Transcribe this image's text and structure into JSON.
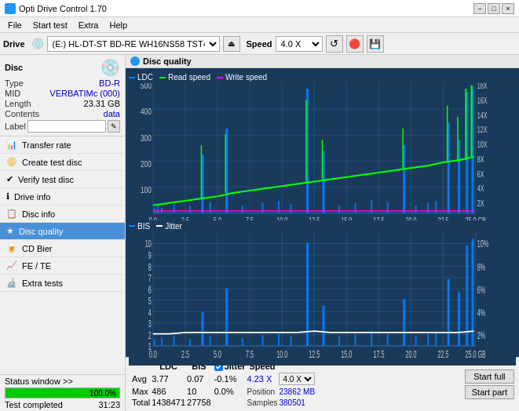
{
  "app": {
    "title": "Opti Drive Control 1.70",
    "icon": "disc-icon"
  },
  "titlebar": {
    "minimize": "−",
    "maximize": "□",
    "close": "×"
  },
  "menu": {
    "items": [
      "File",
      "Start test",
      "Extra",
      "Help"
    ]
  },
  "drive_bar": {
    "drive_label": "Drive",
    "drive_value": "(E:)  HL-DT-ST BD-RE  WH16NS58 TST4",
    "speed_label": "Speed",
    "speed_value": "4.0 X"
  },
  "disc": {
    "title": "Disc",
    "type_label": "Type",
    "type_value": "BD-R",
    "mid_label": "MID",
    "mid_value": "VERBATIMc (000)",
    "length_label": "Length",
    "length_value": "23.31 GB",
    "contents_label": "Contents",
    "contents_value": "data",
    "label_label": "Label",
    "label_placeholder": ""
  },
  "nav": {
    "items": [
      {
        "id": "transfer-rate",
        "label": "Transfer rate",
        "icon": "chart-icon"
      },
      {
        "id": "create-test-disc",
        "label": "Create test disc",
        "icon": "disc-write-icon"
      },
      {
        "id": "verify-test-disc",
        "label": "Verify test disc",
        "icon": "verify-icon"
      },
      {
        "id": "drive-info",
        "label": "Drive info",
        "icon": "info-icon"
      },
      {
        "id": "disc-info",
        "label": "Disc info",
        "icon": "disc-info-icon"
      },
      {
        "id": "disc-quality",
        "label": "Disc quality",
        "icon": "quality-icon",
        "active": true
      },
      {
        "id": "cd-bier",
        "label": "CD Bier",
        "icon": "cd-icon"
      },
      {
        "id": "fe-te",
        "label": "FE / TE",
        "icon": "fe-icon"
      },
      {
        "id": "extra-tests",
        "label": "Extra tests",
        "icon": "extra-icon"
      }
    ]
  },
  "status_window": {
    "label": "Status window >>",
    "progress": 100.0,
    "progress_text": "100.0%",
    "status_text": "Test completed",
    "time": "31:23"
  },
  "chart": {
    "title": "Disc quality",
    "top": {
      "legend": [
        "LDC",
        "Read speed",
        "Write speed"
      ],
      "y_max": 500,
      "y_right_max": 18,
      "x_max": 25,
      "y_labels": [
        "500",
        "400",
        "300",
        "200",
        "100"
      ],
      "y_right_labels": [
        "18X",
        "16X",
        "14X",
        "12X",
        "10X",
        "8X",
        "6X",
        "4X",
        "2X"
      ],
      "x_labels": [
        "0.0",
        "2.5",
        "5.0",
        "7.5",
        "10.0",
        "12.5",
        "15.0",
        "17.5",
        "20.0",
        "22.5",
        "25.0 GB"
      ]
    },
    "bottom": {
      "legend": [
        "BIS",
        "Jitter"
      ],
      "y_max": 10,
      "y_right_max": 10,
      "x_max": 25,
      "y_labels": [
        "10",
        "9",
        "8",
        "7",
        "6",
        "5",
        "4",
        "3",
        "2",
        "1"
      ],
      "y_right_labels": [
        "10%",
        "8%",
        "6%",
        "4%",
        "2%"
      ],
      "x_labels": [
        "0.0",
        "2.5",
        "5.0",
        "7.5",
        "10.0",
        "12.5",
        "15.0",
        "17.5",
        "20.0",
        "22.5",
        "25.0 GB"
      ]
    }
  },
  "stats": {
    "headers": [
      "",
      "LDC",
      "BIS",
      "",
      "Jitter",
      "Speed",
      ""
    ],
    "avg_label": "Avg",
    "avg_ldc": "3.77",
    "avg_bis": "0.07",
    "avg_jitter": "-0.1%",
    "max_label": "Max",
    "max_ldc": "486",
    "max_bis": "10",
    "max_jitter": "0.0%",
    "total_label": "Total",
    "total_ldc": "1438471",
    "total_bis": "27758",
    "jitter_checked": true,
    "speed_label": "Speed",
    "speed_value": "4.23 X",
    "speed_select": "4.0 X",
    "position_label": "Position",
    "position_value": "23862 MB",
    "samples_label": "Samples",
    "samples_value": "380501",
    "start_full_label": "Start full",
    "start_part_label": "Start part"
  }
}
